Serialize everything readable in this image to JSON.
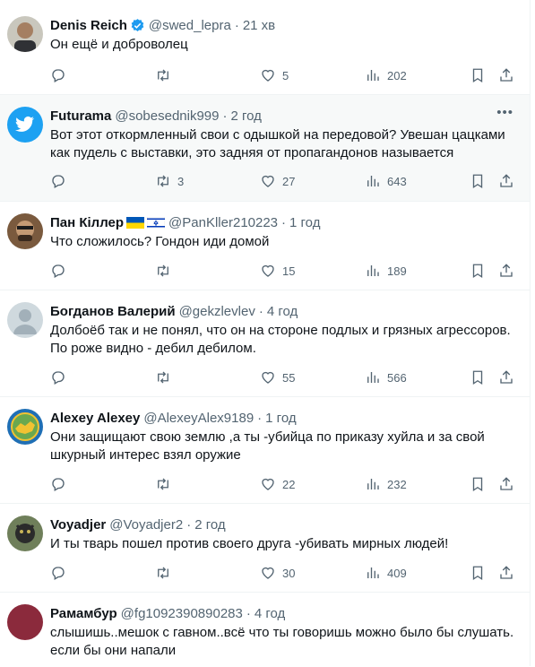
{
  "tweets": [
    {
      "name": "Denis Reich",
      "handle": "@swed_lepra",
      "time": "21 хв",
      "text": "Он ещё и доброволец",
      "replies": "",
      "retweets": "",
      "likes": "5",
      "views": "202",
      "verified": true
    },
    {
      "name": "Futurama",
      "handle": "@sobesednik999",
      "time": "2 год",
      "text": "Вот этот откормленный свои с одышкой на передовой? Увешан цацками как пудель с выставки, это задняя от пропагандонов называется",
      "replies": "",
      "retweets": "3",
      "likes": "27",
      "views": "643"
    },
    {
      "name": "Пан Кіллер",
      "handle": "@PanKller210223",
      "time": "1 год",
      "text": "Что сложилось? Гондон иди домой",
      "replies": "",
      "retweets": "",
      "likes": "15",
      "views": "189"
    },
    {
      "name": "Богданов Валерий",
      "handle": "@gekzlevlev",
      "time": "4 год",
      "text": "Долбоёб так и не понял, что он на стороне подлых и грязных агрессоров. По роже видно - дебил дебилом.",
      "replies": "",
      "retweets": "",
      "likes": "55",
      "views": "566"
    },
    {
      "name": "Alexey Alexey",
      "handle": "@AlexeyAlex9189",
      "time": "1 год",
      "text": "Они защищают свою землю ,а ты -убийца по приказу хуйла и за свой шкурный интерес взял оружие",
      "replies": "",
      "retweets": "",
      "likes": "22",
      "views": "232"
    },
    {
      "name": "Voyadjer",
      "handle": "@Voyadjer2",
      "time": "2 год",
      "text": "И ты тварь пошел против своего друга -убивать мирных людей!",
      "replies": "",
      "retweets": "",
      "likes": "30",
      "views": "409"
    },
    {
      "name": "Рамамбур",
      "handle": "@fg1092390890283",
      "time": "4 год",
      "text": "слышишь..мешок с гавном..всё что ты говоришь можно было бы слушать. если бы они напали",
      "replies": "",
      "retweets": "",
      "likes": "",
      "views": ""
    }
  ],
  "colors": {
    "accent": "#1d9bf0",
    "muted": "#536471",
    "text": "#0f1419",
    "shaded_bg": "#f7f9f9"
  }
}
